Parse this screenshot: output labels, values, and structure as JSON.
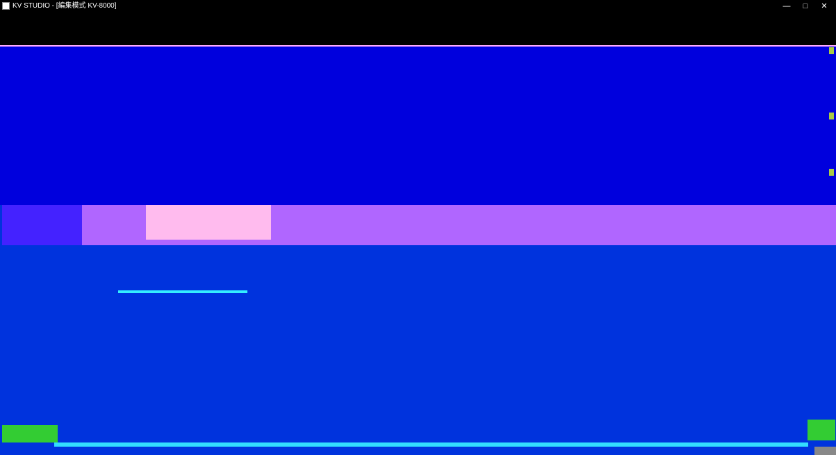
{
  "window": {
    "title": "KV STUDIO - [編集模式 KV-8000]",
    "min_label": "—",
    "max_label": "□",
    "close_label": "✕"
  },
  "colors": {
    "title_bg": "#000000",
    "upper_bg": "#0000dd",
    "selection_band": "#b066ff",
    "selection_panel": "#ffbbee",
    "lower_bg": "#0033dd",
    "status_cyan": "#33ddff",
    "accent_green": "#33cc33"
  },
  "icons": {
    "app": "kv-studio-icon",
    "tree_node": "folder-icon",
    "module": "module-icon"
  }
}
